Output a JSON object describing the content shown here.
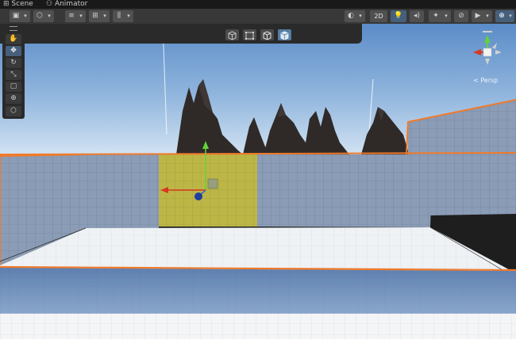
{
  "tabs": [
    {
      "label": "Scene",
      "icon": "grid-icon",
      "active": true
    },
    {
      "label": "Animator",
      "icon": "animator-icon",
      "active": false
    }
  ],
  "toolbar": {
    "toggle_2d_label": "2D",
    "left_tools": [
      "draw-mode-icon",
      "shading-icon",
      "gizmo-align-icon",
      "snap-grid-icon",
      "increment-snap-icon"
    ],
    "right_tools": [
      "global-lighting-icon",
      "lighting-icon",
      "audio-icon",
      "effects-icon",
      "hidden-objects-icon",
      "camera-icon",
      "gizmos-icon"
    ]
  },
  "overlay_toolbar": {
    "items": [
      "box-icon",
      "rect-icon",
      "cube-icon",
      "cube-filled-icon"
    ],
    "active_index": 3
  },
  "tools_panel": {
    "items": [
      "hand-icon",
      "move-icon",
      "rotate-icon",
      "scale-icon",
      "rect-transform-icon",
      "transform-icon",
      "custom-tool-icon"
    ],
    "active_index": 1
  },
  "orientation_gizmo": {
    "view_label": "< Persp"
  },
  "colors": {
    "sky_top": "#5e8ec9",
    "sky_bottom": "#cfe0f2",
    "wall": "#8b9cb6",
    "floor": "#eef1f4",
    "selection_outline": "#f07a2a",
    "highlight_panel": "#bdb84a",
    "axis_x": "#d9381e",
    "axis_y": "#62d23b",
    "axis_z": "#2f5fd6"
  }
}
